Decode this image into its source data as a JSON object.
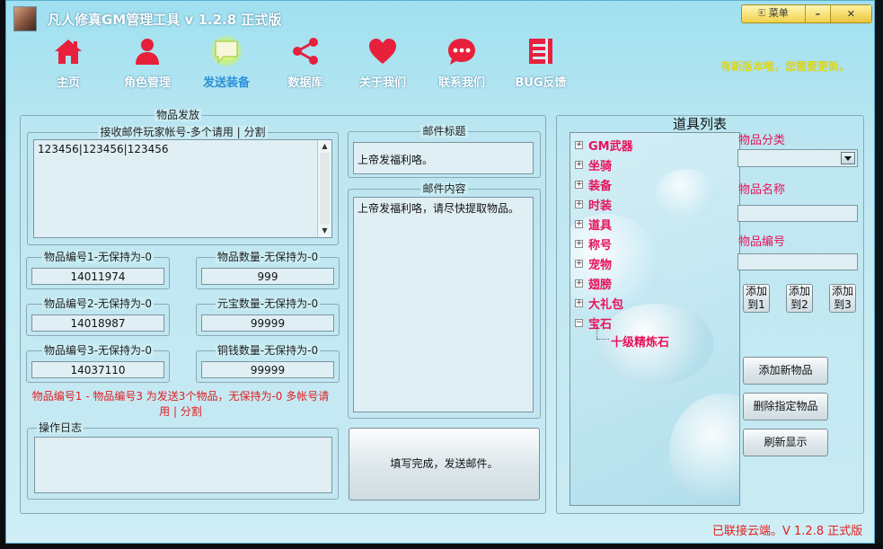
{
  "window": {
    "title": "凡人修真GM管理工具  v 1.2.8 正式版",
    "controls": {
      "menu": "🗉 菜单",
      "minimize": "–",
      "close": "✕"
    }
  },
  "nav": {
    "items": [
      {
        "label": "主页",
        "icon": "home-icon"
      },
      {
        "label": "角色管理",
        "icon": "person-icon"
      },
      {
        "label": "发送装备",
        "icon": "chat-bubble-icon"
      },
      {
        "label": "数据库",
        "icon": "share-icon"
      },
      {
        "label": "关于我们",
        "icon": "heart-icon"
      },
      {
        "label": "联系我们",
        "icon": "message-dots-icon"
      },
      {
        "label": "BUG反馈",
        "icon": "grid-block-icon"
      }
    ],
    "update_note": "有新版本啦，您需要更新。"
  },
  "send": {
    "group_title": "物品发放",
    "accounts_title": "接收邮件玩家帐号-多个请用 | 分割",
    "accounts_value": "123456|123456|123456",
    "item1_title": "物品编号1-无保持为-0",
    "item1_value": "14011974",
    "item2_title": "物品编号2-无保持为-0",
    "item2_value": "14018987",
    "item3_title": "物品编号3-无保持为-0",
    "item3_value": "14037110",
    "qty_title": "物品数量-无保持为-0",
    "qty_value": "999",
    "yuanbao_title": "元宝数量-无保持为-0",
    "yuanbao_value": "99999",
    "copper_title": "铜钱数量-无保持为-0",
    "copper_value": "99999",
    "hint": "物品编号1 - 物品编号3 为发送3个物品，无保持为-0 多帐号请用 | 分割"
  },
  "log": {
    "title": "操作日志"
  },
  "mail": {
    "subject_title": "邮件标题",
    "subject_value": "上帝发福利咯。",
    "body_title": "邮件内容",
    "body_value": "上帝发福利咯，请尽快提取物品。",
    "send_button": "填写完成，发送邮件。"
  },
  "items_panel": {
    "title": "道具列表",
    "tree": [
      {
        "label": "GM武器",
        "expanded": false
      },
      {
        "label": "坐骑",
        "expanded": false
      },
      {
        "label": "装备",
        "expanded": false
      },
      {
        "label": "时装",
        "expanded": false
      },
      {
        "label": "道具",
        "expanded": false
      },
      {
        "label": "称号",
        "expanded": false
      },
      {
        "label": "宠物",
        "expanded": false
      },
      {
        "label": "翅膀",
        "expanded": false
      },
      {
        "label": "大礼包",
        "expanded": false
      },
      {
        "label": "宝石",
        "expanded": true
      }
    ],
    "tree_child": "十级精炼石",
    "category_label": "物品分类",
    "category_value": "",
    "name_label": "物品名称",
    "name_value": "",
    "id_label": "物品编号",
    "id_value": "",
    "add1": "添加\n到1",
    "add2": "添加\n到2",
    "add3": "添加\n到3",
    "add_new": "添加新物品",
    "delete": "删除指定物品",
    "refresh": "刷新显示"
  },
  "status": "已联接云端。V 1.2.8 正式版",
  "colors": {
    "accent_red": "#e8125a",
    "status_red": "#e02020",
    "nav_active": "#2a8fd8",
    "notice_yellow": "#f5e600"
  }
}
